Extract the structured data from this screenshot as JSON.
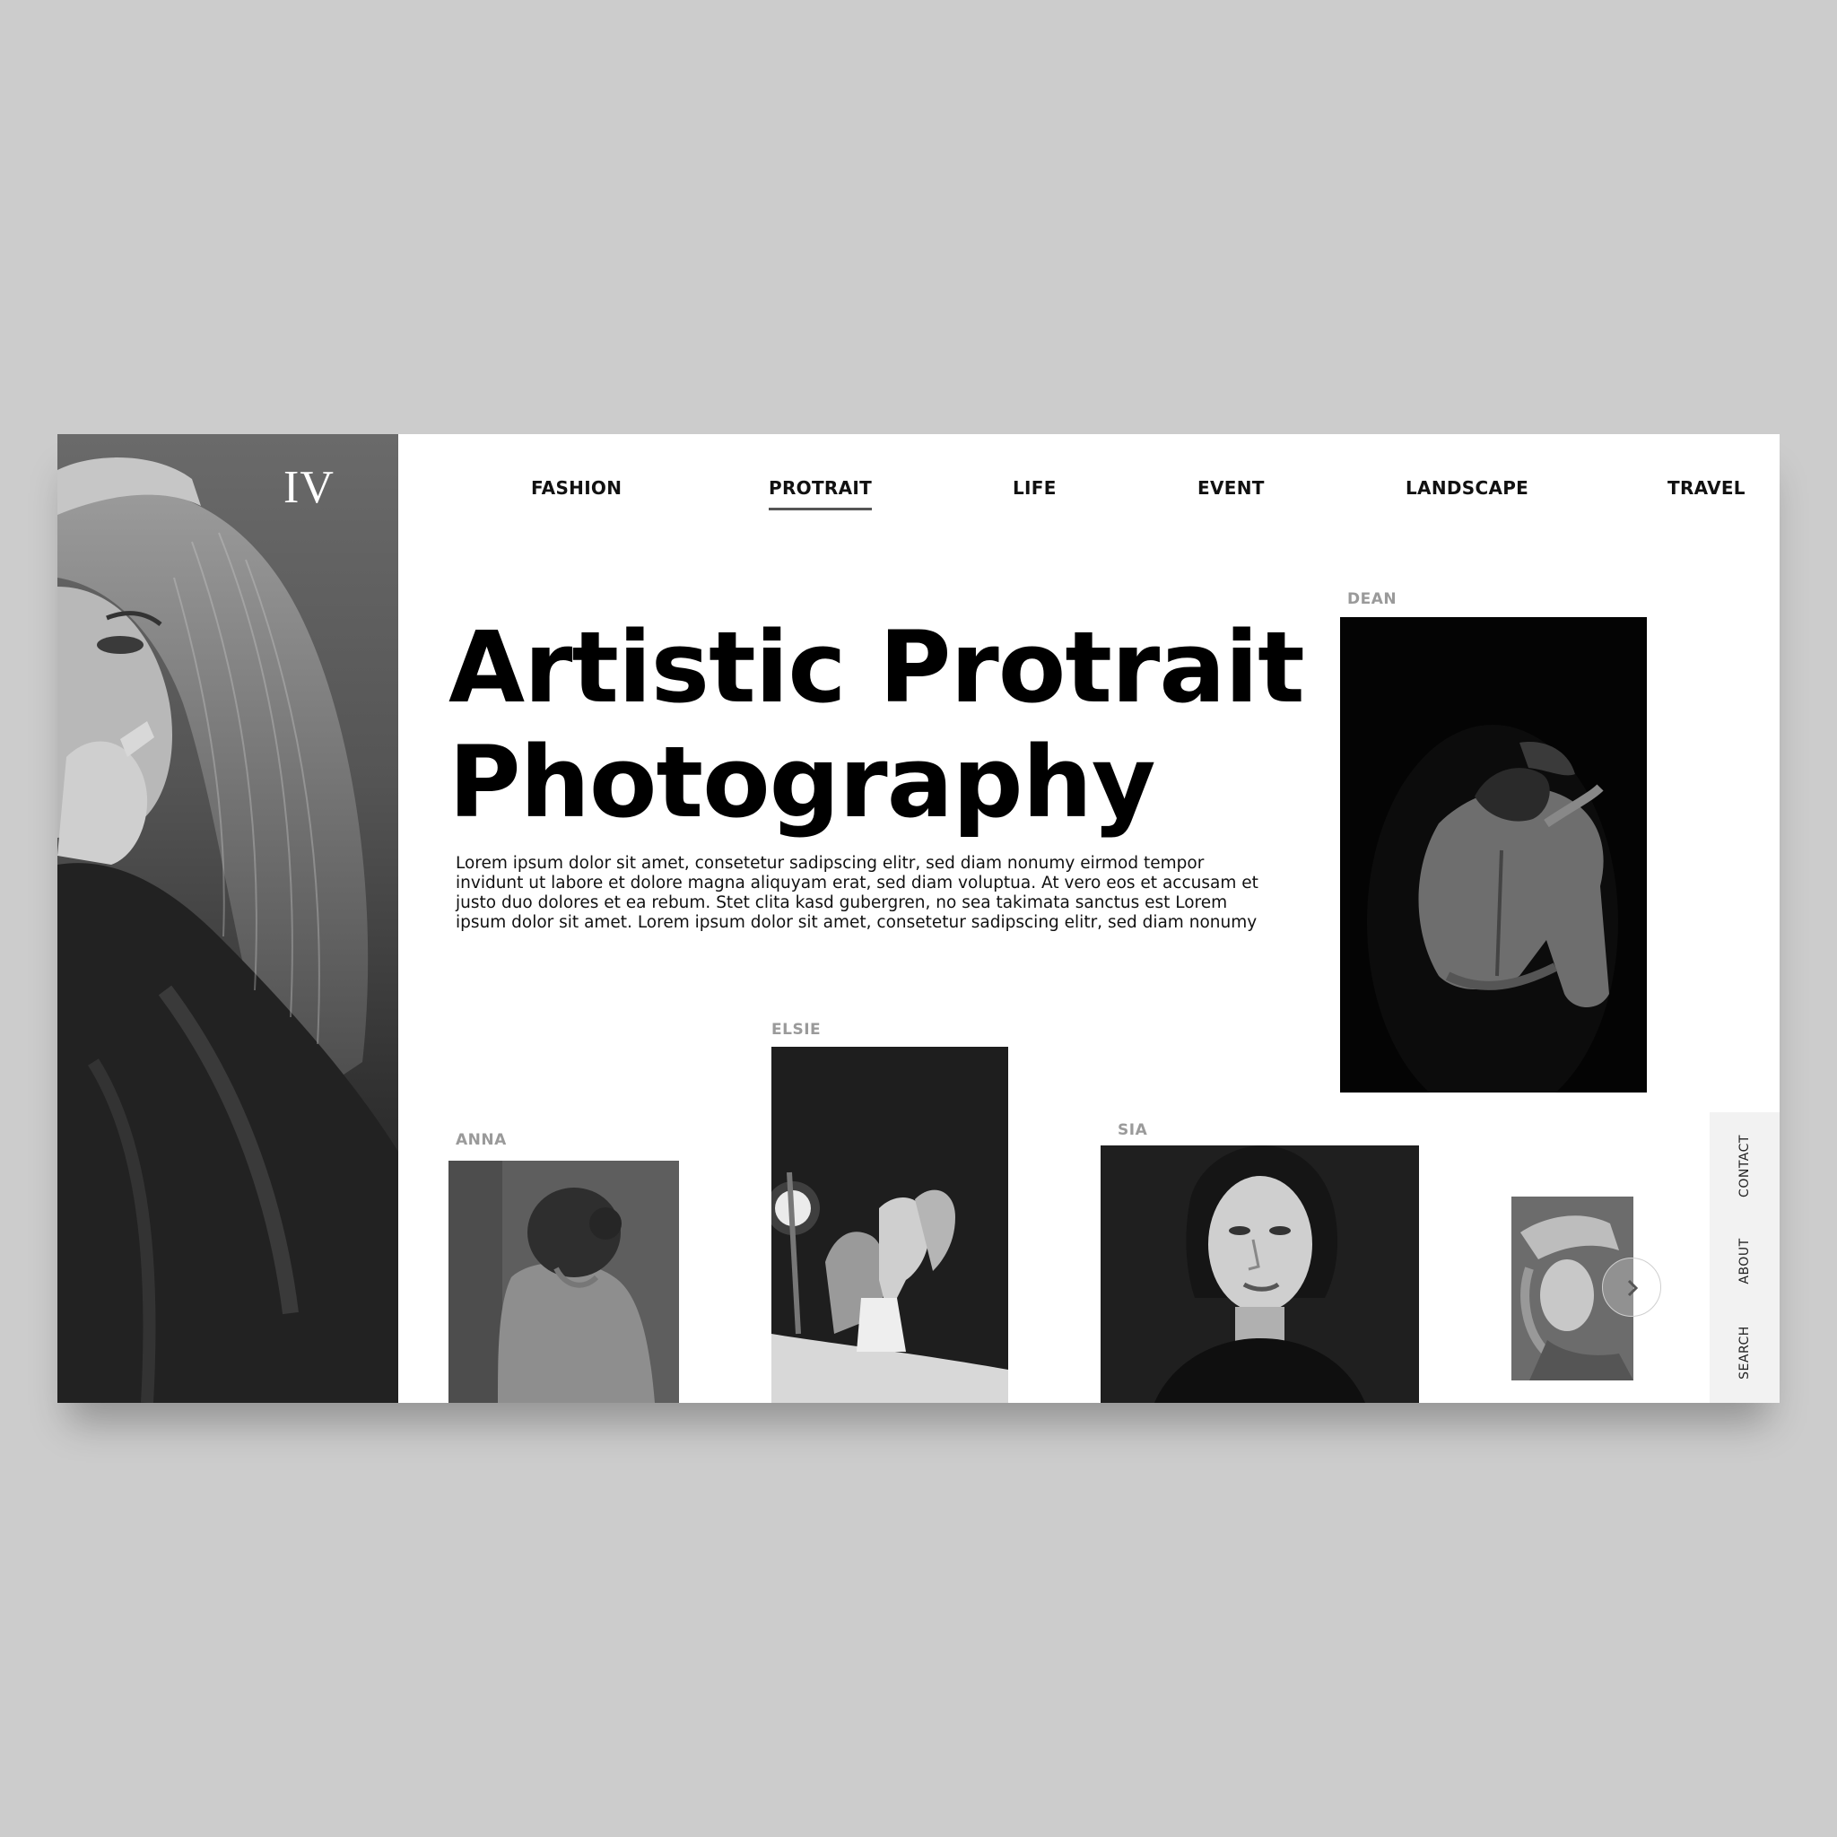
{
  "brand": {
    "logo": "IV"
  },
  "nav": {
    "items": [
      {
        "label": "FASHION"
      },
      {
        "label": "PROTRAIT"
      },
      {
        "label": "LIFE"
      },
      {
        "label": "EVENT"
      },
      {
        "label": "LANDSCAPE"
      },
      {
        "label": "TRAVEL"
      }
    ],
    "active": "PROTRAIT"
  },
  "hero": {
    "title_line1": "Artistic Protrait",
    "title_line2": "Photography",
    "description": "Lorem ipsum dolor sit amet, consetetur sadipscing elitr, sed diam nonumy eirmod tempor invidunt ut labore et dolore magna aliquyam erat, sed diam voluptua. At vero eos et accusam et justo duo dolores et ea rebum. Stet clita kasd gubergren, no sea takimata sanctus est Lorem ipsum dolor sit amet. Lorem ipsum dolor sit amet, consetetur sadipscing elitr, sed diam nonumy"
  },
  "gallery": {
    "dean": "DEAN",
    "elsie": "ELSIE",
    "anna": "ANNA",
    "sia": "SIA"
  },
  "side_menu": {
    "contact": "CONTACT",
    "about": "ABOUT",
    "search": "SEARCH"
  },
  "colors": {
    "background": "#cccccc",
    "page": "#ffffff",
    "text": "#000000",
    "label": "#9a9a9a",
    "sidebar": "#f2f2f2"
  },
  "icons": {
    "next": "chevron-right-icon"
  }
}
